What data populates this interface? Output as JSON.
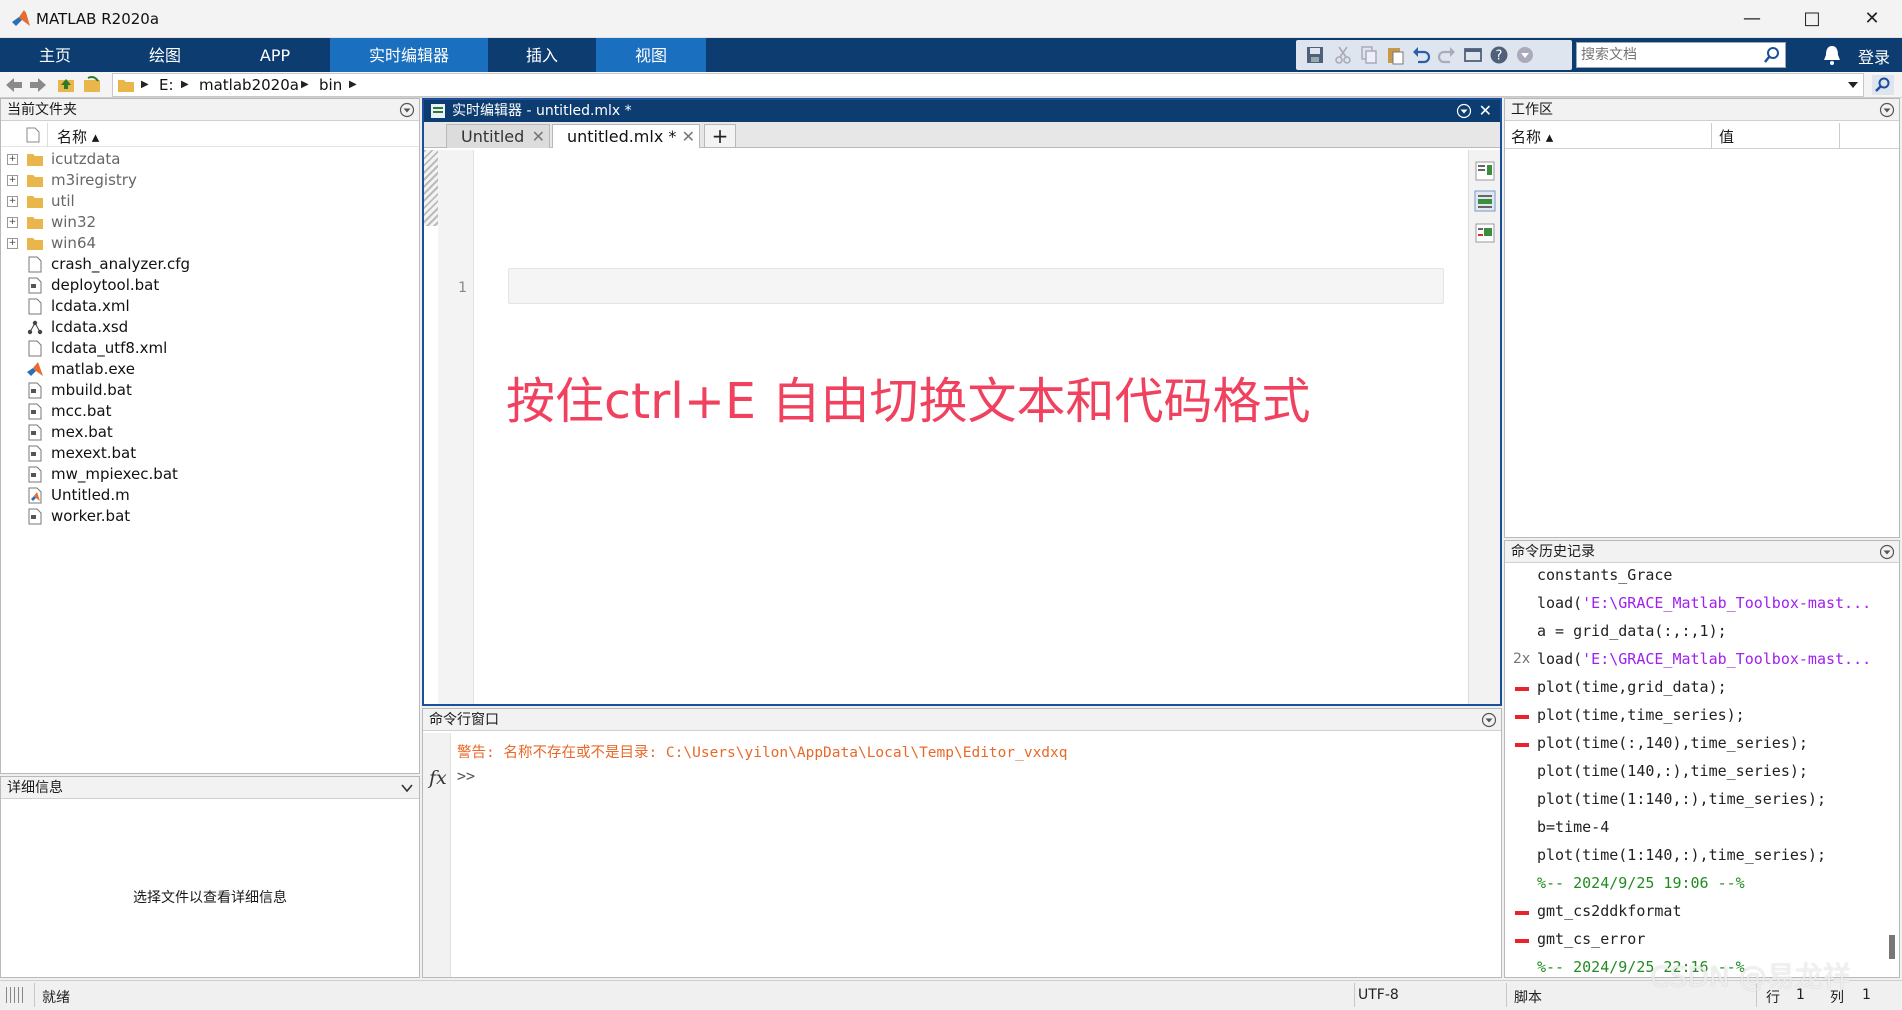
{
  "window": {
    "title": "MATLAB R2020a"
  },
  "ribbon": {
    "tabs": [
      {
        "label": "主页"
      },
      {
        "label": "绘图"
      },
      {
        "label": "APP"
      },
      {
        "label": "实时编辑器"
      },
      {
        "label": "插入"
      },
      {
        "label": "视图"
      }
    ],
    "active_tab": "实时编辑器",
    "search_placeholder": "搜索文档",
    "login_label": "登录"
  },
  "address": {
    "crumbs": [
      "E:",
      "matlab2020a",
      "bin"
    ]
  },
  "file_browser": {
    "title": "当前文件夹",
    "column_name": "名称 ▴",
    "files": [
      {
        "name": "icutzdata",
        "type": "folder"
      },
      {
        "name": "m3iregistry",
        "type": "folder"
      },
      {
        "name": "util",
        "type": "folder"
      },
      {
        "name": "win32",
        "type": "folder"
      },
      {
        "name": "win64",
        "type": "folder"
      },
      {
        "name": "crash_analyzer.cfg",
        "type": "file"
      },
      {
        "name": "deploytool.bat",
        "type": "bat"
      },
      {
        "name": "lcdata.xml",
        "type": "file"
      },
      {
        "name": "lcdata.xsd",
        "type": "xsd"
      },
      {
        "name": "lcdata_utf8.xml",
        "type": "file"
      },
      {
        "name": "matlab.exe",
        "type": "matlab"
      },
      {
        "name": "mbuild.bat",
        "type": "bat"
      },
      {
        "name": "mcc.bat",
        "type": "bat"
      },
      {
        "name": "mex.bat",
        "type": "bat"
      },
      {
        "name": "mexext.bat",
        "type": "bat"
      },
      {
        "name": "mw_mpiexec.bat",
        "type": "bat"
      },
      {
        "name": "Untitled.m",
        "type": "mfile"
      },
      {
        "name": "worker.bat",
        "type": "bat"
      }
    ]
  },
  "details": {
    "title": "详细信息",
    "message": "选择文件以查看详细信息"
  },
  "editor": {
    "title": "实时编辑器 - untitled.mlx *",
    "tabs": [
      {
        "label": "Untitled"
      },
      {
        "label": "untitled.mlx *"
      }
    ],
    "line_number": "1",
    "overlay_text": "按住ctrl+E 自由切换文本和代码格式"
  },
  "command_window": {
    "title": "命令行窗口",
    "warning": "警告: 名称不存在或不是目录: C:\\Users\\yilon\\AppData\\Local\\Temp\\Editor_vxdxq",
    "prompt": ">>",
    "fx": "fx"
  },
  "workspace": {
    "title": "工作区",
    "col_name": "名称 ▴",
    "col_value": "值"
  },
  "history": {
    "title": "命令历史记录",
    "items": [
      {
        "text": "constants_Grace",
        "mark": false,
        "count": ""
      },
      {
        "pre": "load(",
        "str": "'E:\\GRACE_Matlab_Toolbox-mast...",
        "mark": false,
        "count": ""
      },
      {
        "text": "a = grid_data(:,:,1);",
        "mark": false,
        "count": ""
      },
      {
        "pre": "load(",
        "str": "'E:\\GRACE_Matlab_Toolbox-mast...",
        "mark": false,
        "count": "2x"
      },
      {
        "text": "plot(time,grid_data);",
        "mark": true,
        "count": ""
      },
      {
        "text": "plot(time,time_series);",
        "mark": true,
        "count": ""
      },
      {
        "text": "plot(time(:,140),time_series);",
        "mark": true,
        "count": ""
      },
      {
        "text": "plot(time(140,:),time_series);",
        "mark": false,
        "count": ""
      },
      {
        "text": "plot(time(1:140,:),time_series);",
        "mark": false,
        "count": ""
      },
      {
        "text": "b=time-4",
        "mark": false,
        "count": ""
      },
      {
        "text": "plot(time(1:140,:),time_series);",
        "mark": false,
        "count": ""
      },
      {
        "text": "%-- 2024/9/25 19:06 --%",
        "mark": false,
        "count": "",
        "comment": true
      },
      {
        "text": "gmt_cs2ddkformat",
        "mark": true,
        "count": ""
      },
      {
        "text": "gmt_cs_error",
        "mark": true,
        "count": ""
      },
      {
        "text": "%-- 2024/9/25 22:16 --%",
        "mark": false,
        "count": "",
        "comment": true
      }
    ]
  },
  "statusbar": {
    "status": "就绪",
    "encoding": "UTF-8",
    "mode": "脚本",
    "row_label": "行",
    "row_value": "1",
    "col_label": "列",
    "col_value": "1"
  },
  "watermark": "CSDN @易龙祥",
  "colors": {
    "ribbon_bg": "#0d3c70",
    "ribbon_active": "#1b6fbf",
    "overlay_text": "#f0415f",
    "warning": "#e8692a",
    "history_mark": "#e8242a",
    "history_string": "#a020f0",
    "history_comment": "#228b22"
  }
}
